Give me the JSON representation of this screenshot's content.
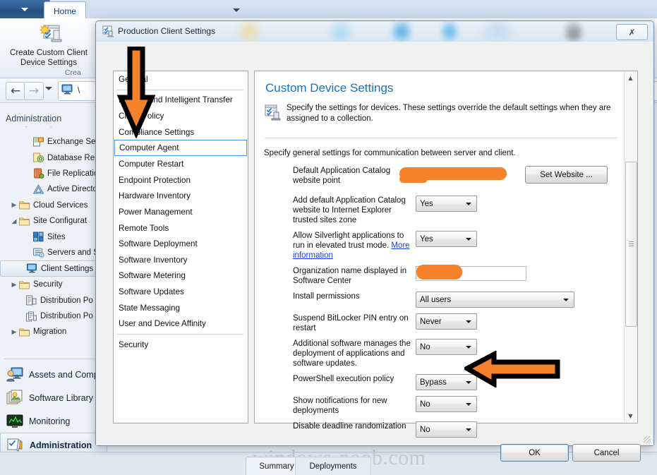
{
  "app": {
    "ribbon": {
      "app_menu_icon": "chevron-down-icon",
      "tab_home": "Home",
      "create_button_label": "Create Custom Client\nDevice Settings",
      "create_button_line1": "Create Custom Client",
      "create_button_line2": "Device Settings",
      "group_label": "Crea"
    },
    "navbar": {
      "back_icon": "back-arrow-icon",
      "forward_icon": "forward-arrow-icon",
      "history_dropdown_icon": "chevron-down-icon",
      "address_icon": "monitor-icon",
      "address_text": "\\"
    },
    "tree": {
      "title": "Administration",
      "items": [
        {
          "label": "Exchange Ser",
          "icon": "exchange-server-icon",
          "indent": 3,
          "expander": "",
          "selected": false
        },
        {
          "label": "Database Rep",
          "icon": "database-replication-icon",
          "indent": 3,
          "expander": "",
          "selected": false
        },
        {
          "label": "File Replicatio",
          "icon": "file-replication-icon",
          "indent": 3,
          "expander": "",
          "selected": false
        },
        {
          "label": "Active Directo",
          "icon": "active-directory-icon",
          "indent": 3,
          "expander": "",
          "selected": false
        },
        {
          "label": "Cloud Services",
          "icon": "folder-icon",
          "indent": 1,
          "expander": "collapsed",
          "selected": false
        },
        {
          "label": "Site Configurat",
          "icon": "folder-icon",
          "indent": 1,
          "expander": "expanded",
          "selected": false
        },
        {
          "label": "Sites",
          "icon": "sites-icon",
          "indent": 3,
          "expander": "",
          "selected": false
        },
        {
          "label": "Servers and S",
          "icon": "servers-icon",
          "indent": 3,
          "expander": "",
          "selected": false
        },
        {
          "label": "Client Settings",
          "icon": "monitor-icon",
          "indent": 2,
          "expander": "",
          "selected": true
        },
        {
          "label": "Security",
          "icon": "folder-icon",
          "indent": 1,
          "expander": "collapsed",
          "selected": false
        },
        {
          "label": "Distribution Po",
          "icon": "distribution-point-icon",
          "indent": 2,
          "expander": "",
          "selected": false
        },
        {
          "label": "Distribution Po",
          "icon": "distribution-point-group-icon",
          "indent": 2,
          "expander": "",
          "selected": false
        },
        {
          "label": "Migration",
          "icon": "folder-icon",
          "indent": 1,
          "expander": "collapsed",
          "selected": false
        }
      ]
    },
    "workspaces": [
      {
        "label": "Assets and Comp",
        "icon": "assets-and-compliance-icon",
        "selected": false
      },
      {
        "label": "Software Library",
        "icon": "software-library-icon",
        "selected": false
      },
      {
        "label": "Monitoring",
        "icon": "monitoring-icon",
        "selected": false
      },
      {
        "label": "Administration",
        "icon": "administration-icon",
        "selected": true
      }
    ],
    "bottom_tabs": [
      {
        "label": "Summary",
        "active": true
      },
      {
        "label": "Deployments",
        "active": false
      }
    ],
    "watermark": "windows-noob.com"
  },
  "dialog": {
    "title": "Production Client Settings",
    "title_icon": "client-settings-icon",
    "close_button_label": "✗",
    "nav_list": [
      {
        "label": "General",
        "selected": false,
        "separator_after": true
      },
      {
        "label": "Background Intelligent Transfer",
        "selected": false
      },
      {
        "label": "Client Policy",
        "selected": false
      },
      {
        "label": "Compliance Settings",
        "selected": false
      },
      {
        "label": "Computer Agent",
        "selected": true
      },
      {
        "label": "Computer Restart",
        "selected": false
      },
      {
        "label": "Endpoint Protection",
        "selected": false
      },
      {
        "label": "Hardware Inventory",
        "selected": false
      },
      {
        "label": "Power Management",
        "selected": false
      },
      {
        "label": "Remote Tools",
        "selected": false
      },
      {
        "label": "Software Deployment",
        "selected": false
      },
      {
        "label": "Software Inventory",
        "selected": false
      },
      {
        "label": "Software Metering",
        "selected": false
      },
      {
        "label": "Software Updates",
        "selected": false
      },
      {
        "label": "State Messaging",
        "selected": false
      },
      {
        "label": "User and Device Affinity",
        "selected": false,
        "separator_after": true
      },
      {
        "label": "Security",
        "selected": false
      }
    ],
    "pane": {
      "heading": "Custom Device Settings",
      "heading_icon": "custom-device-settings-icon",
      "description": "Specify the settings for devices. These settings override the default settings when they are assigned to a collection.",
      "subheading": "Specify general settings for communication between server and client."
    },
    "settings": [
      {
        "label": "Default Application Catalog website point",
        "control": "redacted-plus-button",
        "button_label": "Set Website ...",
        "value": ""
      },
      {
        "label": "Add default Application Catalog website to Internet Explorer trusted sites zone",
        "control": "combo-small",
        "value": "Yes"
      },
      {
        "label": "Allow Silverlight applications to run in elevated trust mode.",
        "label_link": "More information",
        "control": "combo-small",
        "value": "Yes"
      },
      {
        "label": "Organization name displayed in Software Center",
        "control": "textbox-redacted",
        "value": ""
      },
      {
        "label": "Install permissions",
        "control": "combo-wide",
        "value": "All users"
      },
      {
        "label": "Suspend BitLocker PIN entry on restart",
        "control": "combo-small",
        "value": "Never"
      },
      {
        "label": "Additional software manages the deployment of applications and software updates.",
        "control": "combo-small",
        "value": "No"
      },
      {
        "label": "PowerShell execution policy",
        "control": "combo-small",
        "value": "Bypass"
      },
      {
        "label": "Show notifications for new deployments",
        "control": "combo-small",
        "value": "No",
        "annotated": true
      },
      {
        "label": "Disable deadline randomization",
        "control": "combo-small",
        "value": "No"
      }
    ],
    "scrollbar": {
      "up_icon": "scroll-up-icon",
      "down_icon": "scroll-down-icon"
    },
    "ok_label": "OK",
    "cancel_label": "Cancel"
  },
  "annotations": {
    "arrow_color": "#f5822a",
    "outline_color": "#000000",
    "down_arrow_target": "Computer Agent",
    "left_arrow_target": "Show notifications for new deployments"
  },
  "colors": {
    "accent_blue": "#1273c4",
    "redaction_orange": "#f5822a",
    "selection_blue": "#3e97e8",
    "link_blue": "#1b3fd4"
  }
}
